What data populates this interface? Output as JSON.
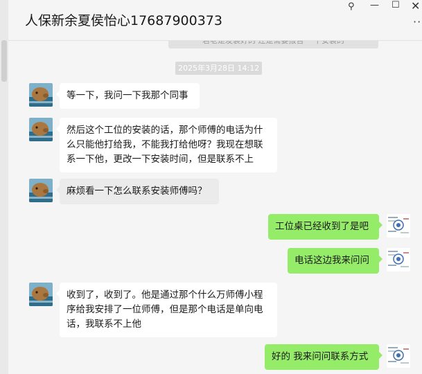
{
  "window": {
    "title": "人保新余夏侯怡心17687900373",
    "pin_icon": "⚲",
    "minimize_icon": "—",
    "maximize_icon": "☐",
    "close_icon": "✕",
    "more_icon": "···"
  },
  "chat": {
    "previous_system_text": "若老是发装好的 还是需要报告 一下安装的",
    "timestamp": "2025年3月28日 14:12",
    "messages": [
      {
        "side": "in",
        "text": "等一下，我问一下我那个同事"
      },
      {
        "side": "in",
        "text": "然后这个工位的安装的话，那个师傅的电话为什么只能他打给我，不能我打给他呀？我现在想联系一下他，更改一下安装时间，但是联系不上"
      },
      {
        "side": "in",
        "text": "麻烦看一下怎么联系安装师傅吗？"
      },
      {
        "side": "out",
        "text": "工位桌已经收到了是吧"
      },
      {
        "side": "out",
        "text": "电话这边我来问问"
      },
      {
        "side": "in",
        "text": "收到了，收到了。他是通过那个什么万师傅小程序给我安排了一位师傅，但是那个电话是单向电话，我联系不上他"
      },
      {
        "side": "out",
        "text": "好的 我来问问联系方式"
      }
    ]
  }
}
